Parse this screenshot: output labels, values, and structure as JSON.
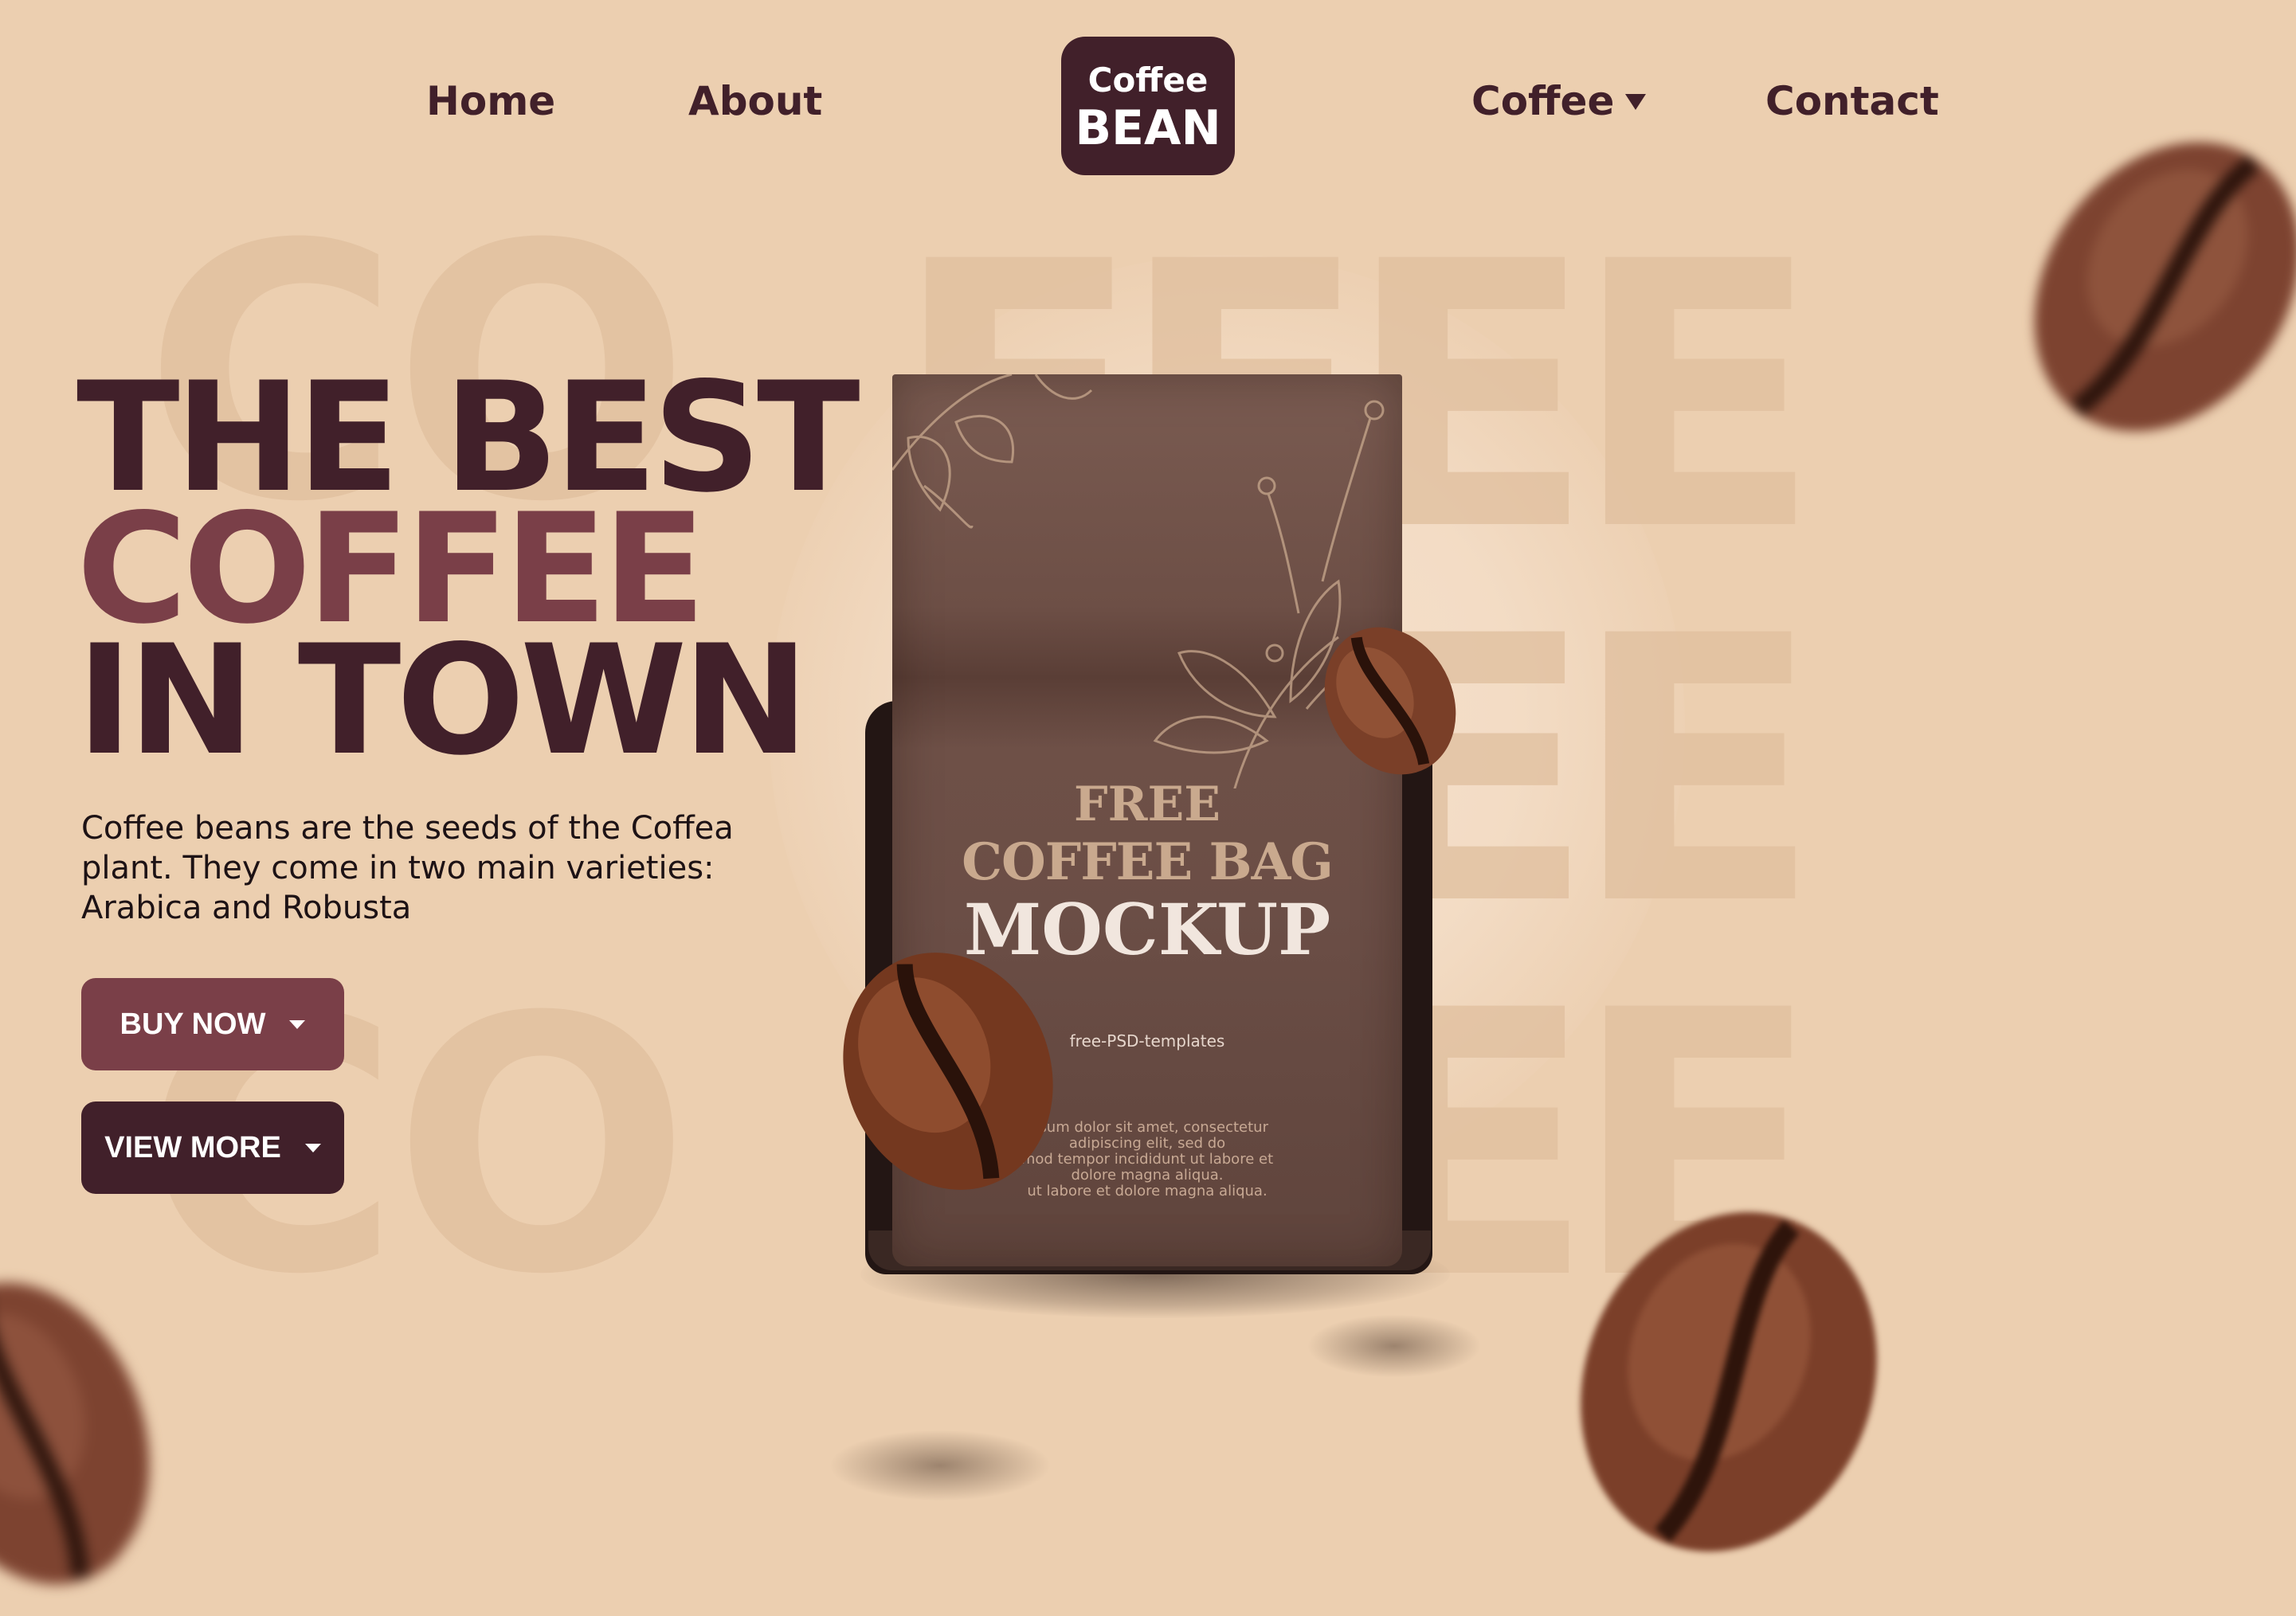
{
  "nav": {
    "home": "Home",
    "about": "About",
    "coffee": "Coffee",
    "contact": "Contact"
  },
  "logo": {
    "line1": "Coffee",
    "line2": "BEAN"
  },
  "hero": {
    "line1": "THE BEST",
    "line2": "COFFEE",
    "line3": "IN TOWN",
    "description": "Coffee beans are the seeds of the Coffea plant. They come in two main varieties: Arabica and Robusta"
  },
  "buttons": {
    "buy_now": "BUY NOW",
    "view_more": "VIEW MORE"
  },
  "background_words": {
    "left_word": "CO",
    "right_word": "FFEE"
  },
  "product": {
    "line1": "FREE",
    "line2": "COFFEE BAG",
    "line3": "MOCKUP",
    "brand": "free-PSD-templates",
    "lorem1": "ipsum dolor sit amet, consectetur",
    "lorem2": "adipiscing elit, sed do",
    "lorem3": "mod tempor incididunt ut labore et",
    "lorem4": "dolore magna aliqua.",
    "lorem5": "ut labore et dolore magna aliqua."
  },
  "colors": {
    "background": "#eccfb0",
    "dark_brown": "#41202a",
    "accent_maroon": "#7a3f48"
  }
}
